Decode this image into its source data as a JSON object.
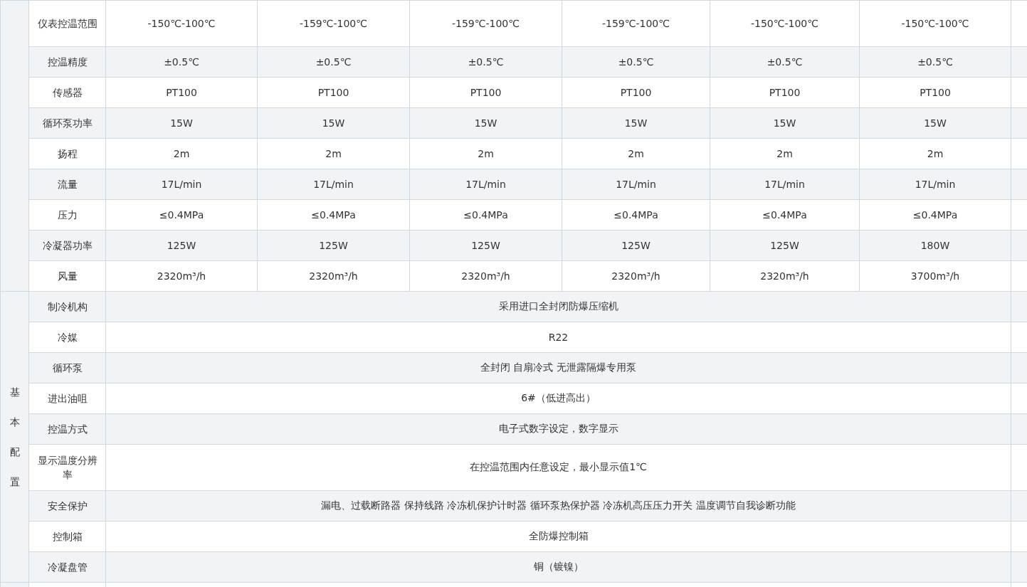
{
  "spec_table": {
    "groups": [
      {
        "rows": [
          {
            "label": "仪表控温范围",
            "values": [
              "-150℃-100℃",
              "-159℃-100℃",
              "-159℃-100℃",
              "-159℃-100℃",
              "-150℃-100℃",
              "-150℃-100℃"
            ]
          },
          {
            "label": "控温精度",
            "values": [
              "±0.5℃",
              "±0.5℃",
              "±0.5℃",
              "±0.5℃",
              "±0.5℃",
              "±0.5℃"
            ]
          },
          {
            "label": "传感器",
            "values": [
              "PT100",
              "PT100",
              "PT100",
              "PT100",
              "PT100",
              "PT100"
            ]
          },
          {
            "label": "循环泵功率",
            "values": [
              "15W",
              "15W",
              "15W",
              "15W",
              "15W",
              "15W"
            ]
          },
          {
            "label": "扬程",
            "values": [
              "2m",
              "2m",
              "2m",
              "2m",
              "2m",
              "2m"
            ]
          },
          {
            "label": "流量",
            "values": [
              "17L/min",
              "17L/min",
              "17L/min",
              "17L/min",
              "17L/min",
              "17L/min"
            ]
          },
          {
            "label": "压力",
            "values": [
              "≤0.4MPa",
              "≤0.4MPa",
              "≤0.4MPa",
              "≤0.4MPa",
              "≤0.4MPa",
              "≤0.4MPa"
            ]
          },
          {
            "label": "冷凝器功率",
            "values": [
              "125W",
              "125W",
              "125W",
              "125W",
              "125W",
              "180W"
            ]
          },
          {
            "label": "风量",
            "values": [
              "2320m³/h",
              "2320m³/h",
              "2320m³/h",
              "2320m³/h",
              "2320m³/h",
              "3700m³/h"
            ]
          }
        ]
      },
      {
        "label": "基本配置",
        "rows": [
          {
            "label": "制冷机构",
            "value": "采用进口全封闭防爆压缩机"
          },
          {
            "label": "冷媒",
            "value": "R22"
          },
          {
            "label": "循环泵",
            "value": "全封闭 自扇冷式 无泄露隔爆专用泵"
          },
          {
            "label": "进出油咀",
            "value": "6#（低进高出）"
          },
          {
            "label": "控温方式",
            "value": "电子式数字设定，数字显示"
          },
          {
            "label": "显示温度分辨率",
            "value": "在控温范围内任意设定，最小显示值1℃"
          },
          {
            "label": "安全保护",
            "value": "漏电、过载断路器 保持线路 冷冻机保护计时器 循环泵热保护器  冷冻机高压压力开关 温度调节自我诊断功能"
          },
          {
            "label": "控制箱",
            "value": "全防爆控制箱"
          },
          {
            "label": "冷凝盘管",
            "value": "铜（镀镍）"
          }
        ]
      }
    ]
  }
}
